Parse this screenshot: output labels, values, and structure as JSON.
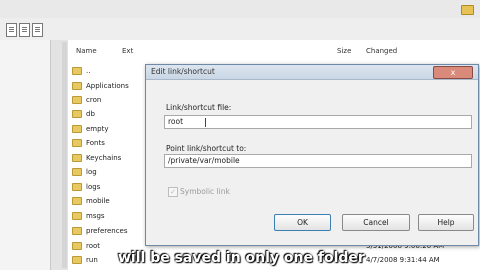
{
  "columns": {
    "name": "Name",
    "ext": "Ext",
    "size": "Size",
    "changed": "Changed"
  },
  "rows": [
    {
      "label": ".."
    },
    {
      "label": "Applications"
    },
    {
      "label": "cron"
    },
    {
      "label": "db"
    },
    {
      "label": "empty"
    },
    {
      "label": "Fonts"
    },
    {
      "label": "Keychains"
    },
    {
      "label": "log"
    },
    {
      "label": "logs"
    },
    {
      "label": "mobile"
    },
    {
      "label": "msgs"
    },
    {
      "label": "preferences"
    },
    {
      "label": "root",
      "date": "3/31/2008 9:06:26 AM"
    },
    {
      "label": "run",
      "date": "4/7/2008 9:31:44 AM"
    }
  ],
  "dialog": {
    "title": "Edit link/shortcut",
    "close_label": "x",
    "link_label": "Link/shortcut file:",
    "link_value": "root",
    "point_label": "Point link/shortcut to:",
    "point_value": "/private/var/mobile",
    "symbolic_label": "Symbolic link",
    "ok": "OK",
    "cancel": "Cancel",
    "help": "Help"
  },
  "caption": "will be saved in only one folder",
  "colors": {
    "folder": "#e8c860",
    "accent": "#3c7fb1",
    "close": "#d98a7a"
  }
}
